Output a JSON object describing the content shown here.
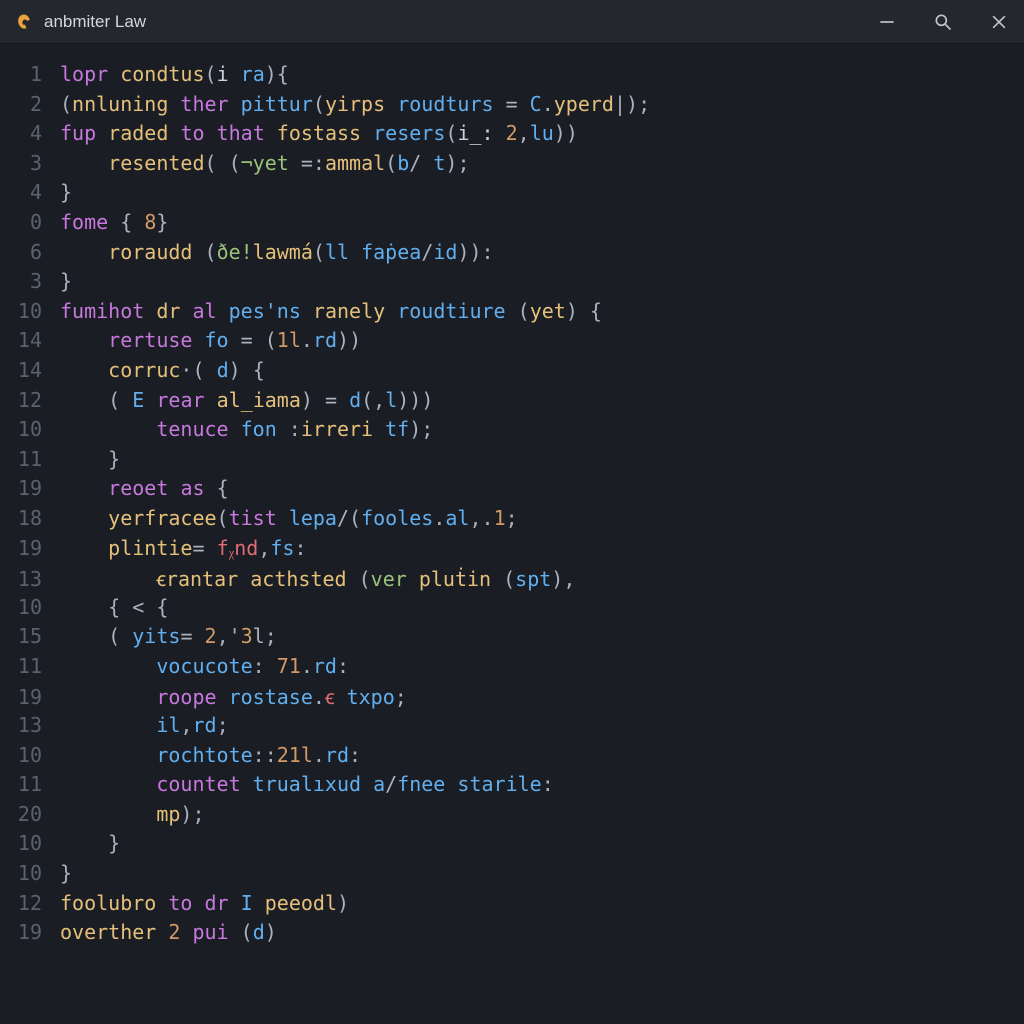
{
  "window": {
    "title": "anbmiter Law",
    "icons": {
      "app": "app-logo-icon",
      "minimize": "minimize-icon",
      "search": "search-icon",
      "close": "close-icon"
    }
  },
  "editor": {
    "lines": [
      {
        "num": "1",
        "tokens": [
          [
            "kw",
            "lopr"
          ],
          [
            "pl",
            " "
          ],
          [
            "fn",
            "condtus"
          ],
          [
            "op",
            "("
          ],
          [
            "pl",
            "i "
          ],
          [
            "id",
            "ra"
          ],
          [
            "op",
            ")"
          ],
          [
            "op",
            "{"
          ]
        ]
      },
      {
        "num": "2",
        "tokens": [
          [
            "op",
            "("
          ],
          [
            "fn",
            "nnluning"
          ],
          [
            "pl",
            " "
          ],
          [
            "kw",
            "ther"
          ],
          [
            "pl",
            " "
          ],
          [
            "id",
            "pittur"
          ],
          [
            "op",
            "("
          ],
          [
            "fn",
            "yirps"
          ],
          [
            "pl",
            " "
          ],
          [
            "id",
            "roudturs"
          ],
          [
            "pl",
            " "
          ],
          [
            "op",
            "="
          ],
          [
            "pl",
            " "
          ],
          [
            "id",
            "C"
          ],
          [
            "op",
            "."
          ],
          [
            "fn",
            "yperd"
          ],
          [
            "op",
            "|"
          ],
          [
            "op",
            ")"
          ],
          [
            "op",
            ";"
          ]
        ]
      },
      {
        "num": "4",
        "tokens": [
          [
            "kw",
            "fup"
          ],
          [
            "pl",
            " "
          ],
          [
            "fn",
            "raded"
          ],
          [
            "pl",
            " "
          ],
          [
            "kw",
            "to"
          ],
          [
            "pl",
            " "
          ],
          [
            "kw",
            "that"
          ],
          [
            "pl",
            " "
          ],
          [
            "fn",
            "fostass"
          ],
          [
            "pl",
            " "
          ],
          [
            "id",
            "resers"
          ],
          [
            "op",
            "("
          ],
          [
            "pl",
            "i_: "
          ],
          [
            "num",
            "2"
          ],
          [
            "op",
            ","
          ],
          [
            "id",
            "lu"
          ],
          [
            "op",
            "))"
          ]
        ]
      },
      {
        "num": "3",
        "tokens": [
          [
            "pl",
            "    "
          ],
          [
            "fn",
            "resented"
          ],
          [
            "op",
            "("
          ],
          [
            "pl",
            " "
          ],
          [
            "op",
            "("
          ],
          [
            "str",
            "¬yet"
          ],
          [
            "pl",
            " "
          ],
          [
            "op",
            "="
          ],
          [
            "op",
            ":"
          ],
          [
            "fn",
            "ammal"
          ],
          [
            "op",
            "("
          ],
          [
            "id",
            "b"
          ],
          [
            "op",
            "/"
          ],
          [
            "pl",
            " "
          ],
          [
            "id",
            "t"
          ],
          [
            "op",
            ")"
          ],
          [
            "op",
            ";"
          ]
        ]
      },
      {
        "num": "4",
        "tokens": [
          [
            "op",
            "}"
          ]
        ]
      },
      {
        "num": "0",
        "tokens": [
          [
            "kw",
            "fome"
          ],
          [
            "pl",
            " "
          ],
          [
            "op",
            "{"
          ],
          [
            "pl",
            " "
          ],
          [
            "num",
            "8"
          ],
          [
            "op",
            "}"
          ]
        ]
      },
      {
        "num": "6",
        "tokens": [
          [
            "pl",
            "    "
          ],
          [
            "fn",
            "roraudd"
          ],
          [
            "pl",
            " "
          ],
          [
            "op",
            "("
          ],
          [
            "str",
            "ðe!"
          ],
          [
            "fn",
            "lawmá"
          ],
          [
            "op",
            "("
          ],
          [
            "id",
            "ll"
          ],
          [
            "pl",
            " "
          ],
          [
            "id",
            "faṗea"
          ],
          [
            "op",
            "/"
          ],
          [
            "id",
            "id"
          ],
          [
            "op",
            "))"
          ],
          [
            "op",
            ":"
          ]
        ]
      },
      {
        "num": "3",
        "tokens": [
          [
            "op",
            "}"
          ]
        ]
      },
      {
        "num": "10",
        "tokens": [
          [
            "kw",
            "fumihot"
          ],
          [
            "pl",
            " "
          ],
          [
            "fn",
            "dr"
          ],
          [
            "pl",
            " "
          ],
          [
            "kw",
            "al"
          ],
          [
            "pl",
            " "
          ],
          [
            "id",
            "pes'ns"
          ],
          [
            "pl",
            " "
          ],
          [
            "fn",
            "ranely"
          ],
          [
            "pl",
            " "
          ],
          [
            "id",
            "roudtiure"
          ],
          [
            "pl",
            " "
          ],
          [
            "op",
            "("
          ],
          [
            "fn",
            "yet"
          ],
          [
            "op",
            ")"
          ],
          [
            "pl",
            " "
          ],
          [
            "op",
            "{"
          ]
        ]
      },
      {
        "num": "14",
        "tokens": [
          [
            "pl",
            "    "
          ],
          [
            "kw",
            "rertuse"
          ],
          [
            "pl",
            " "
          ],
          [
            "id",
            "fo"
          ],
          [
            "pl",
            " "
          ],
          [
            "op",
            "="
          ],
          [
            "pl",
            " "
          ],
          [
            "op",
            "("
          ],
          [
            "num",
            "1l"
          ],
          [
            "op",
            "."
          ],
          [
            "id",
            "rd"
          ],
          [
            "op",
            "))"
          ]
        ]
      },
      {
        "num": "14",
        "tokens": [
          [
            "pl",
            "    "
          ],
          [
            "fn",
            "corruc"
          ],
          [
            "op",
            "·"
          ],
          [
            "op",
            "("
          ],
          [
            "pl",
            " "
          ],
          [
            "id",
            "d"
          ],
          [
            "op",
            ")"
          ],
          [
            "pl",
            " "
          ],
          [
            "op",
            "{"
          ]
        ]
      },
      {
        "num": "12",
        "tokens": [
          [
            "pl",
            "    "
          ],
          [
            "op",
            "("
          ],
          [
            "pl",
            " "
          ],
          [
            "id",
            "E"
          ],
          [
            "pl",
            " "
          ],
          [
            "kw",
            "rear"
          ],
          [
            "pl",
            " "
          ],
          [
            "fn",
            "al_iama"
          ],
          [
            "op",
            ")"
          ],
          [
            "pl",
            " "
          ],
          [
            "op",
            "="
          ],
          [
            "pl",
            " "
          ],
          [
            "id",
            "d"
          ],
          [
            "op",
            "("
          ],
          [
            "op",
            ","
          ],
          [
            "id",
            "l"
          ],
          [
            "op",
            ")))"
          ]
        ]
      },
      {
        "num": "10",
        "tokens": [
          [
            "pl",
            "        "
          ],
          [
            "kw",
            "tenuce"
          ],
          [
            "pl",
            " "
          ],
          [
            "id",
            "fon"
          ],
          [
            "pl",
            " "
          ],
          [
            "op",
            ":"
          ],
          [
            "fn",
            "irreri"
          ],
          [
            "pl",
            " "
          ],
          [
            "id",
            "tf"
          ],
          [
            "op",
            ")"
          ],
          [
            "op",
            ";"
          ]
        ]
      },
      {
        "num": "11",
        "tokens": [
          [
            "pl",
            "    "
          ],
          [
            "op",
            "}"
          ]
        ]
      },
      {
        "num": "19",
        "tokens": [
          [
            "pl",
            "    "
          ],
          [
            "kw",
            "reoet"
          ],
          [
            "pl",
            " "
          ],
          [
            "kw",
            "as"
          ],
          [
            "pl",
            " "
          ],
          [
            "op",
            "{"
          ]
        ]
      },
      {
        "num": "18",
        "tokens": [
          [
            "pl",
            "    "
          ],
          [
            "fn",
            "yerfracee"
          ],
          [
            "op",
            "("
          ],
          [
            "kw",
            "tist"
          ],
          [
            "pl",
            " "
          ],
          [
            "id",
            "lepa"
          ],
          [
            "op",
            "/"
          ],
          [
            "op",
            "("
          ],
          [
            "id",
            "fooles"
          ],
          [
            "op",
            "."
          ],
          [
            "id",
            "al"
          ],
          [
            "op",
            ","
          ],
          [
            "op",
            "."
          ],
          [
            "num",
            "1"
          ],
          [
            "op",
            ";"
          ]
        ]
      },
      {
        "num": "19",
        "tokens": [
          [
            "pl",
            "    "
          ],
          [
            "fn",
            "plintie"
          ],
          [
            "op",
            "="
          ],
          [
            "pl",
            " "
          ],
          [
            "red",
            "fᵪnd"
          ],
          [
            "op",
            ","
          ],
          [
            "id",
            "fs"
          ],
          [
            "op",
            ":"
          ]
        ]
      },
      {
        "num": "13",
        "tokens": [
          [
            "pl",
            "        "
          ],
          [
            "fn",
            "ꞓrantar"
          ],
          [
            "pl",
            " "
          ],
          [
            "fn",
            "acthsted"
          ],
          [
            "pl",
            " "
          ],
          [
            "op",
            "("
          ],
          [
            "str",
            "ver"
          ],
          [
            "pl",
            " "
          ],
          [
            "fn",
            "pluṫin"
          ],
          [
            "pl",
            " "
          ],
          [
            "op",
            "("
          ],
          [
            "id",
            "spt"
          ],
          [
            "op",
            ")"
          ],
          [
            "op",
            ","
          ]
        ]
      },
      {
        "num": "10",
        "tokens": [
          [
            "pl",
            "    "
          ],
          [
            "op",
            "{"
          ],
          [
            "pl",
            " "
          ],
          [
            "op",
            "<"
          ],
          [
            "pl",
            " "
          ],
          [
            "op",
            "{"
          ]
        ]
      },
      {
        "num": "15",
        "tokens": [
          [
            "pl",
            "    "
          ],
          [
            "op",
            "("
          ],
          [
            "pl",
            " "
          ],
          [
            "id",
            "yits"
          ],
          [
            "op",
            "="
          ],
          [
            "pl",
            " "
          ],
          [
            "num",
            "2"
          ],
          [
            "op",
            ","
          ],
          [
            "op",
            "'"
          ],
          [
            "num",
            "3"
          ],
          [
            "op",
            "l"
          ],
          [
            "op",
            ";"
          ]
        ]
      },
      {
        "num": "11",
        "tokens": [
          [
            "pl",
            "        "
          ],
          [
            "id",
            "vocucote"
          ],
          [
            "op",
            ":"
          ],
          [
            "pl",
            " "
          ],
          [
            "num",
            "71"
          ],
          [
            "op",
            "."
          ],
          [
            "id",
            "rd"
          ],
          [
            "op",
            ":"
          ]
        ]
      },
      {
        "num": "19",
        "tokens": [
          [
            "pl",
            "        "
          ],
          [
            "kw",
            "roope"
          ],
          [
            "pl",
            " "
          ],
          [
            "id",
            "rostase"
          ],
          [
            "op",
            "."
          ],
          [
            "red",
            "ꞓ"
          ],
          [
            "pl",
            " "
          ],
          [
            "id",
            "txpo"
          ],
          [
            "op",
            ";"
          ]
        ]
      },
      {
        "num": "13",
        "tokens": [
          [
            "pl",
            "        "
          ],
          [
            "id",
            "il"
          ],
          [
            "op",
            ","
          ],
          [
            "id",
            "rd"
          ],
          [
            "op",
            ";"
          ]
        ]
      },
      {
        "num": "10",
        "tokens": [
          [
            "pl",
            "        "
          ],
          [
            "id",
            "rochtote"
          ],
          [
            "op",
            "::"
          ],
          [
            "num",
            "21l"
          ],
          [
            "op",
            "."
          ],
          [
            "id",
            "rd"
          ],
          [
            "op",
            ":"
          ]
        ]
      },
      {
        "num": "11",
        "tokens": [
          [
            "pl",
            "        "
          ],
          [
            "kw",
            "countet"
          ],
          [
            "pl",
            " "
          ],
          [
            "id",
            "trualıxud"
          ],
          [
            "pl",
            " "
          ],
          [
            "id",
            "a"
          ],
          [
            "op",
            "/"
          ],
          [
            "id",
            "fnee"
          ],
          [
            "pl",
            " "
          ],
          [
            "id",
            "starile"
          ],
          [
            "op",
            ":"
          ]
        ]
      },
      {
        "num": "20",
        "tokens": [
          [
            "pl",
            "        "
          ],
          [
            "fn",
            "mp"
          ],
          [
            "op",
            ")"
          ],
          [
            "op",
            ";"
          ]
        ]
      },
      {
        "num": "10",
        "tokens": [
          [
            "pl",
            "    "
          ],
          [
            "op",
            "}"
          ]
        ]
      },
      {
        "num": "10",
        "tokens": [
          [
            "op",
            "}"
          ]
        ]
      },
      {
        "num": "12",
        "tokens": [
          [
            "fn",
            "foolubro"
          ],
          [
            "pl",
            " "
          ],
          [
            "kw",
            "to"
          ],
          [
            "pl",
            " "
          ],
          [
            "kw",
            "dr"
          ],
          [
            "pl",
            " "
          ],
          [
            "id",
            "I"
          ],
          [
            "pl",
            " "
          ],
          [
            "fn",
            "peeodl"
          ],
          [
            "op",
            ")"
          ]
        ]
      },
      {
        "num": "19",
        "tokens": [
          [
            "fn",
            "overther"
          ],
          [
            "pl",
            " "
          ],
          [
            "num",
            "2"
          ],
          [
            "pl",
            " "
          ],
          [
            "kw",
            "pui"
          ],
          [
            "pl",
            " "
          ],
          [
            "op",
            "("
          ],
          [
            "id",
            "d"
          ],
          [
            "op",
            ")"
          ]
        ]
      }
    ]
  }
}
